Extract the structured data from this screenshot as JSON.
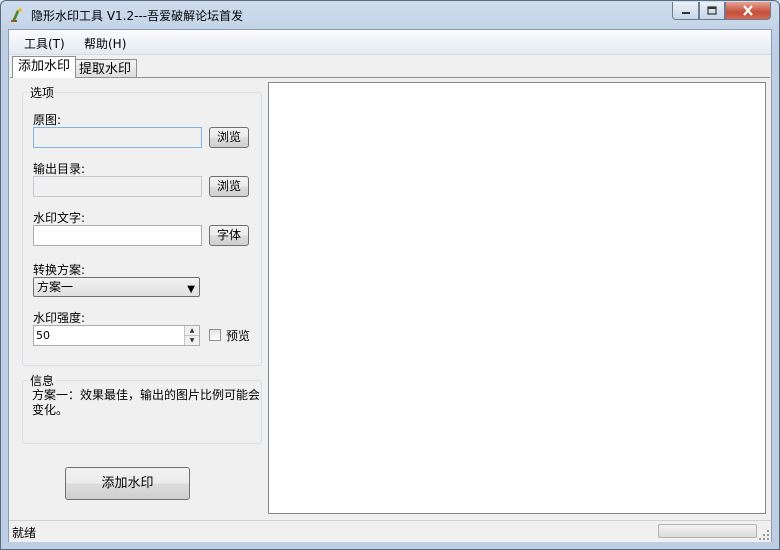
{
  "window": {
    "title": "隐形水印工具 V1.2---吾爱破解论坛首发",
    "icons": {
      "app": "app-icon",
      "minimize": "minimize-icon",
      "maximize": "maximize-icon",
      "close": "close-icon"
    }
  },
  "menu": {
    "items": [
      {
        "label": "工具(T)"
      },
      {
        "label": "帮助(H)"
      }
    ]
  },
  "tabs": [
    {
      "label": "添加水印",
      "active": true
    },
    {
      "label": "提取水印",
      "active": false
    }
  ],
  "options": {
    "group_title": "选项",
    "source_label": "原图:",
    "source_value": "",
    "source_browse": "浏览",
    "output_label": "输出目录:",
    "output_value": "",
    "output_browse": "浏览",
    "text_label": "水印文字:",
    "text_value": "",
    "font_button": "字体",
    "scheme_label": "转换方案:",
    "scheme_selected": "方案一",
    "strength_label": "水印强度:",
    "strength_value": "50",
    "preview_label": "预览",
    "preview_checked": false
  },
  "info": {
    "group_title": "信息",
    "text": "方案一：效果最佳，输出的图片比例可能会变化。"
  },
  "actions": {
    "add_watermark": "添加水印"
  },
  "status": {
    "text": "就绪",
    "progress": 0
  },
  "colors": {
    "titlebar": "#c4d4e8",
    "close_button": "#c44f3c",
    "progress_fill": "#06b025"
  }
}
